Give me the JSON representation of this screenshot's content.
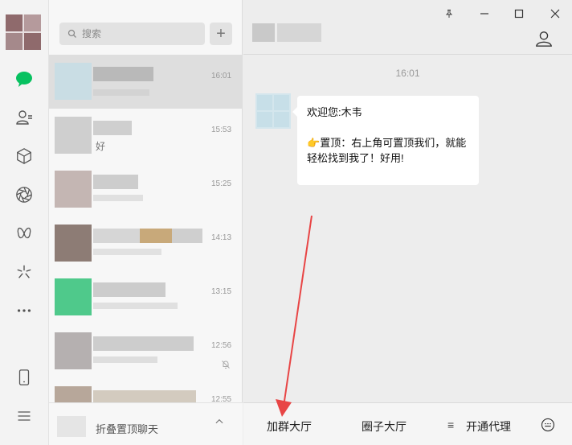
{
  "search": {
    "placeholder": "搜索"
  },
  "chats": [
    {
      "time": "16:01",
      "preview": ""
    },
    {
      "time": "15:53",
      "preview": "好"
    },
    {
      "time": "15:25",
      "preview": ""
    },
    {
      "time": "14:13",
      "preview": ""
    },
    {
      "time": "13:15",
      "preview": ""
    },
    {
      "time": "12:56",
      "preview": ""
    },
    {
      "time": "12:55",
      "preview": ""
    }
  ],
  "footer": {
    "collapsed_label": "折叠置顶聊天"
  },
  "conversation": {
    "timestamp": "16:01",
    "message_line1": "欢迎您:木韦",
    "message_line2_emoji": "👉",
    "message_line2": "置顶：右上角可置顶我们，就能轻松找到我了！好用!"
  },
  "bottom_menu": {
    "join_hall": "加群大厅",
    "circle_hall": "圈子大厅",
    "open_agent_icon": "≡",
    "open_agent": "开通代理"
  },
  "colors": {
    "accent_green": "#07c160",
    "annotation_arrow": "#e84545"
  }
}
